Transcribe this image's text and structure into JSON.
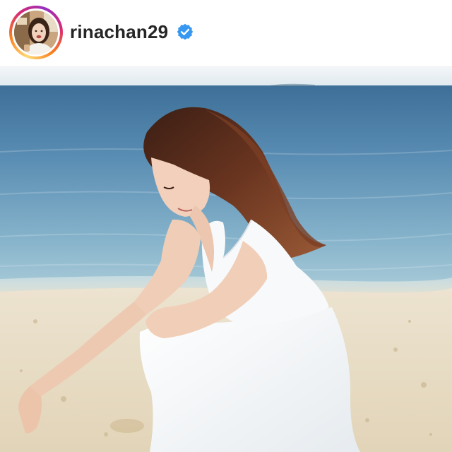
{
  "post": {
    "author": {
      "username": "rinachan29",
      "verified": true,
      "verified_icon": "verified-badge-icon",
      "verified_color": "#3897f0"
    },
    "story_ring_colors": [
      "#feda75",
      "#fa7e1e",
      "#d62976",
      "#962fbf"
    ]
  }
}
